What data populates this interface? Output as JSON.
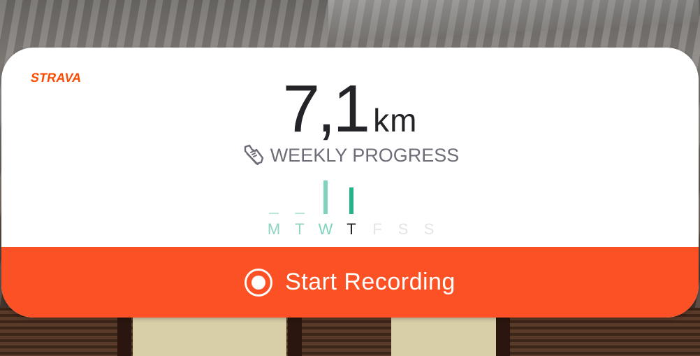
{
  "widget": {
    "brand": "STRAVA",
    "distance_value": "7,1",
    "distance_unit": "km",
    "progress_label": "WEEKLY PROGRESS",
    "progress_icon": "running-shoe-icon",
    "days": [
      {
        "label": "M",
        "state": "past",
        "color": "#8fd3c1",
        "activity": 0
      },
      {
        "label": "T",
        "state": "past",
        "color": "#8fd3c1",
        "activity": 0
      },
      {
        "label": "W",
        "state": "past",
        "color": "#7fd4bd",
        "activity": 1
      },
      {
        "label": "T",
        "state": "today",
        "color": "#26b38a",
        "activity": 0.8
      },
      {
        "label": "F",
        "state": "future",
        "color": "#e4e4e6",
        "activity": null
      },
      {
        "label": "S",
        "state": "future",
        "color": "#e4e4e6",
        "activity": null
      },
      {
        "label": "S",
        "state": "future",
        "color": "#e4e4e6",
        "activity": null
      }
    ],
    "today_label_color": "#242428",
    "record_button_label": "Start Recording",
    "record_icon": "record-icon",
    "accent_color": "#fc5124",
    "brand_color": "#fc4c02"
  }
}
